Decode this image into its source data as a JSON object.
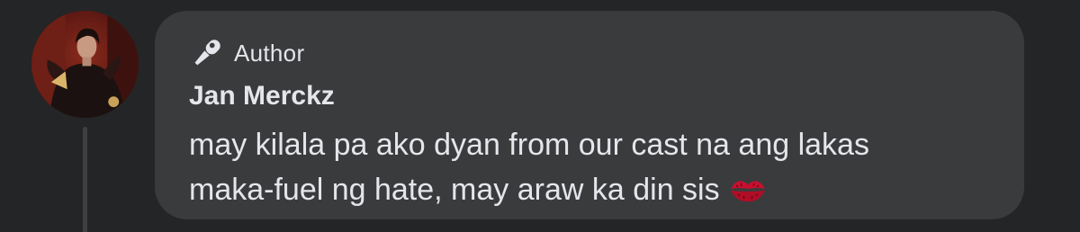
{
  "comment": {
    "badge_label": "Author",
    "badge_icon": "microphone-icon",
    "author_name": "Jan Merckz",
    "text_line_1": "may kilala pa ako dyan from our cast na ang lakas",
    "text_line_2": "maka-fuel ng hate, may araw ka din sis",
    "emoji": "kiss-mark-icon"
  },
  "colors": {
    "background": "#242526",
    "bubble": "#3a3b3c",
    "text": "#e4e6eb",
    "thread_line": "#3e4042",
    "emoji_red": "#c8102e"
  }
}
